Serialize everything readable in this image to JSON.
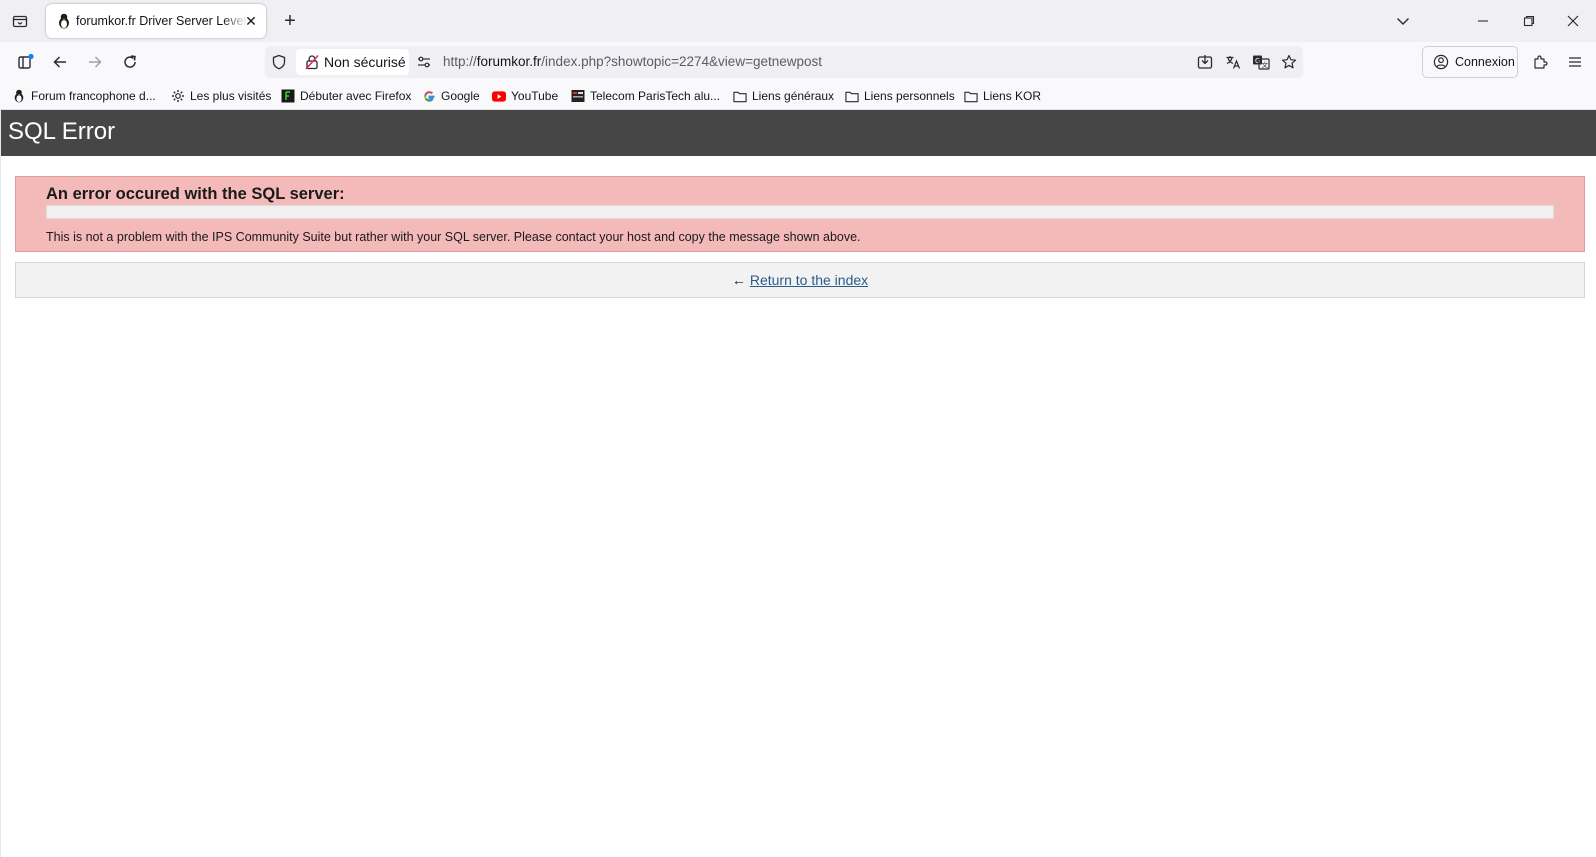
{
  "browser": {
    "tab": {
      "title": "forumkor.fr Driver Server Level",
      "favicon": "penguin-icon"
    },
    "address_bar": {
      "security_label": "Non sécurisé",
      "url_prefix": "http://",
      "url_host": "forumkor.fr",
      "url_path": "/index.php?showtopic=2274&view=getnewpost"
    },
    "account_button_label": "Connexion",
    "bookmarks": [
      {
        "label": "Forum francophone d...",
        "icon": "penguin-icon"
      },
      {
        "label": "Les plus visités",
        "icon": "gear-icon"
      },
      {
        "label": "Débuter avec Firefox",
        "icon": "firefox-icon"
      },
      {
        "label": "Google",
        "icon": "google-icon"
      },
      {
        "label": "YouTube",
        "icon": "youtube-icon"
      },
      {
        "label": "Telecom ParisTech alu...",
        "icon": "telecom-icon"
      },
      {
        "label": "Liens généraux",
        "icon": "folder-icon"
      },
      {
        "label": "Liens personnels",
        "icon": "folder-icon"
      },
      {
        "label": "Liens KOR",
        "icon": "folder-icon"
      }
    ]
  },
  "page": {
    "header_title": "SQL Error",
    "error_title": "An error occured with the SQL server:",
    "error_message": "",
    "error_note": "This is not a problem with the IPS Community Suite but rather with your SQL server. Please contact your host and copy the message shown above.",
    "return_arrow": "←",
    "return_link_label": "Return to the index"
  },
  "colors": {
    "header_bg": "#464646",
    "error_bg": "#f4baba",
    "link": "#2a5c8a"
  }
}
